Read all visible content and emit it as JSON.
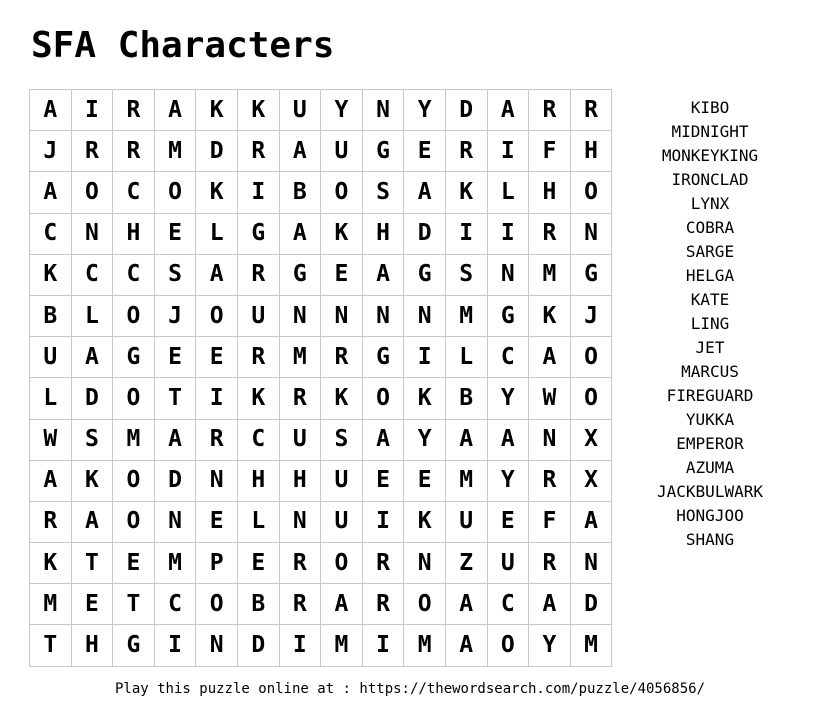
{
  "title": "SFA Characters",
  "grid": [
    [
      "A",
      "I",
      "R",
      "A",
      "K",
      "K",
      "U",
      "Y",
      "N",
      "Y",
      "D",
      "A",
      "R",
      "R"
    ],
    [
      "J",
      "R",
      "R",
      "M",
      "D",
      "R",
      "A",
      "U",
      "G",
      "E",
      "R",
      "I",
      "F",
      "H"
    ],
    [
      "A",
      "O",
      "C",
      "O",
      "K",
      "I",
      "B",
      "O",
      "S",
      "A",
      "K",
      "L",
      "H",
      "O"
    ],
    [
      "C",
      "N",
      "H",
      "E",
      "L",
      "G",
      "A",
      "K",
      "H",
      "D",
      "I",
      "I",
      "R",
      "N"
    ],
    [
      "K",
      "C",
      "C",
      "S",
      "A",
      "R",
      "G",
      "E",
      "A",
      "G",
      "S",
      "N",
      "M",
      "G"
    ],
    [
      "B",
      "L",
      "O",
      "J",
      "O",
      "U",
      "N",
      "N",
      "N",
      "N",
      "M",
      "G",
      "K",
      "J"
    ],
    [
      "U",
      "A",
      "G",
      "E",
      "E",
      "R",
      "M",
      "R",
      "G",
      "I",
      "L",
      "C",
      "A",
      "O"
    ],
    [
      "L",
      "D",
      "O",
      "T",
      "I",
      "K",
      "R",
      "K",
      "O",
      "K",
      "B",
      "Y",
      "W",
      "O"
    ],
    [
      "W",
      "S",
      "M",
      "A",
      "R",
      "C",
      "U",
      "S",
      "A",
      "Y",
      "A",
      "A",
      "N",
      "X"
    ],
    [
      "A",
      "K",
      "O",
      "D",
      "N",
      "H",
      "H",
      "U",
      "E",
      "E",
      "M",
      "Y",
      "R",
      "X"
    ],
    [
      "R",
      "A",
      "O",
      "N",
      "E",
      "L",
      "N",
      "U",
      "I",
      "K",
      "U",
      "E",
      "F",
      "A"
    ],
    [
      "K",
      "T",
      "E",
      "M",
      "P",
      "E",
      "R",
      "O",
      "R",
      "N",
      "Z",
      "U",
      "R",
      "N"
    ],
    [
      "M",
      "E",
      "T",
      "C",
      "O",
      "B",
      "R",
      "A",
      "R",
      "O",
      "A",
      "C",
      "A",
      "D"
    ],
    [
      "T",
      "H",
      "G",
      "I",
      "N",
      "D",
      "I",
      "M",
      "I",
      "M",
      "A",
      "O",
      "Y",
      "M"
    ]
  ],
  "words": [
    "KIBO",
    "MIDNIGHT",
    "MONKEYKING",
    "IRONCLAD",
    "LYNX",
    "COBRA",
    "SARGE",
    "HELGA",
    "KATE",
    "LING",
    "JET",
    "MARCUS",
    "FIREGUARD",
    "YUKKA",
    "EMPEROR",
    "AZUMA",
    "JACKBULWARK",
    "HONGJOO",
    "SHANG"
  ],
  "footer": "Play this puzzle online at : https://thewordsearch.com/puzzle/4056856/"
}
